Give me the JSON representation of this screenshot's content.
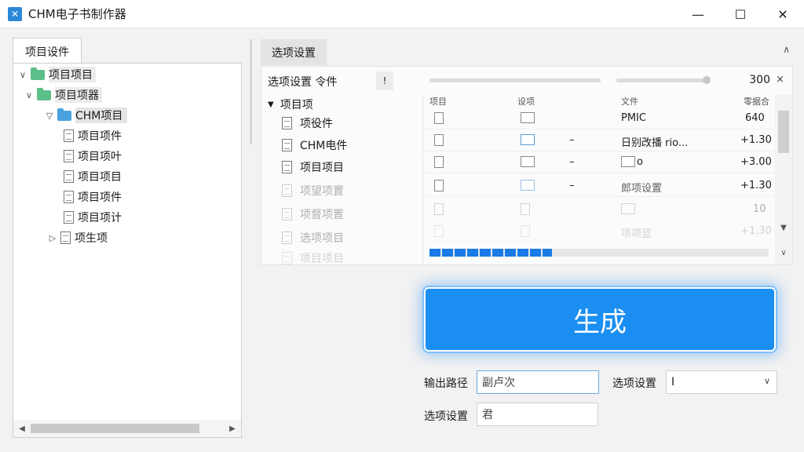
{
  "window": {
    "title": "CHM电子书制作器",
    "controls": {
      "minimize": "—",
      "maximize": "☐",
      "close": "✕"
    }
  },
  "left": {
    "tab": "项目设件",
    "tree": [
      {
        "label": "项目项目",
        "icon": "folder-icon",
        "expander": "∨"
      },
      {
        "label": "项目项器",
        "icon": "folder-icon",
        "expander": "∨"
      },
      {
        "label": "CHM项目",
        "icon": "folder-blue-icon",
        "expander": "▽"
      },
      {
        "label": "项目项件",
        "icon": "document-icon",
        "expander": ""
      },
      {
        "label": "项目项叶",
        "icon": "document-icon",
        "expander": ""
      },
      {
        "label": "项目项目",
        "icon": "document-icon",
        "expander": ""
      },
      {
        "label": "项目项件",
        "icon": "document-icon",
        "expander": ""
      },
      {
        "label": "项目项计",
        "icon": "document-icon",
        "expander": ""
      },
      {
        "label": "项生项",
        "icon": "document-icon",
        "expander": "▷"
      }
    ],
    "scroll_left": "◀",
    "scroll_right": "▶"
  },
  "right": {
    "tab": "选项设置",
    "collapse": "∧",
    "options_label": "选项设置 令件",
    "options_btn": "!",
    "number": "300",
    "close": "×",
    "tree": {
      "root": "项目项",
      "items": [
        "项役件",
        "CHM电件",
        "项目项目",
        "项望项置",
        "项督项置",
        "选项项目",
        "项目项目"
      ]
    },
    "grid": {
      "headers": [
        "项目",
        "设项",
        "文件",
        "零据合"
      ],
      "rows": [
        {
          "name": "PMIC",
          "value": "640"
        },
        {
          "name": "日别改播 rio...",
          "value": "+1.30",
          "dash": "–"
        },
        {
          "name": "o",
          "value": "+3.00",
          "dash": "–"
        },
        {
          "name": "郎项设置",
          "value": "+1.30",
          "dash": "–"
        },
        {
          "name": "",
          "value": "10",
          "dash": ""
        },
        {
          "name": "项项蓝",
          "value": "+1.30",
          "dash": ""
        }
      ]
    },
    "progress": 0.36,
    "scroll_up": "▲",
    "scroll_down": "▼",
    "chevron_down": "∨"
  },
  "generate": {
    "label": "生成"
  },
  "form": {
    "output_label": "输出路径",
    "output_value": "副卢次",
    "option_label_1": "选项设置",
    "option_select_value": "I",
    "option_label_2": "选项设置",
    "option_value_2": "君"
  },
  "colors": {
    "accent": "#1b8ef2",
    "progress": "#1a7be6",
    "folder": "#5bbf8a",
    "folder_selected": "#4aa3df"
  }
}
